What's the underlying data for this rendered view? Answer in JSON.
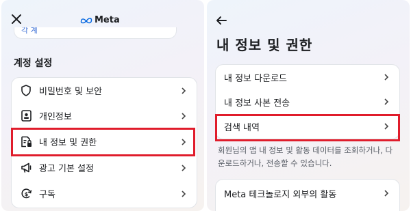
{
  "left": {
    "logo_text": "Meta",
    "partial_link": "각 계",
    "section_title": "계정 설정",
    "menu": [
      {
        "label": "비밀번호 및 보안",
        "icon": "shield-icon"
      },
      {
        "label": "개인정보",
        "icon": "id-card-icon"
      },
      {
        "label": "내 정보 및 권한",
        "icon": "info-permissions-icon",
        "highlighted": true
      },
      {
        "label": "광고 기본 설정",
        "icon": "megaphone-icon"
      },
      {
        "label": "구독",
        "icon": "subscription-icon"
      }
    ]
  },
  "right": {
    "title": "내 정보 및 권한",
    "menu": [
      {
        "label": "내 정보 다운로드"
      },
      {
        "label": "내 정보 사본 전송"
      },
      {
        "label": "검색 내역",
        "highlighted": true
      }
    ],
    "description": "회원님의 앱 내 정보 및 활동 데이터를 조회하거나, 다운로드하거나, 전송할 수 있습니다.",
    "menu2": [
      {
        "label": "Meta 테크놀로지 외부의 활동"
      }
    ]
  },
  "colors": {
    "highlight": "#e01c2b",
    "meta_blue": "#0668e1"
  }
}
